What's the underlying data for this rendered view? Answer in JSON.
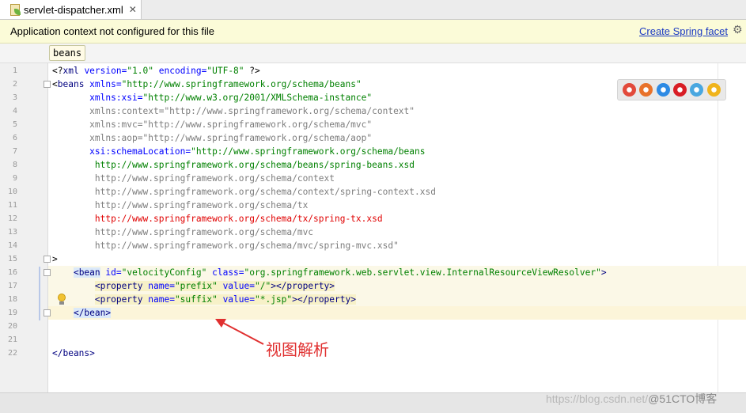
{
  "tab": {
    "label": "servlet-dispatcher.xml",
    "close": "✕",
    "icon": "spring-xml-file-icon"
  },
  "banner": {
    "message": "Application context not configured for this file",
    "link": "Create Spring facet",
    "gear_icon": "gear-icon"
  },
  "breadcrumb": {
    "item": "beans"
  },
  "editor": {
    "line_numbers": [
      "1",
      "2",
      "3",
      "4",
      "5",
      "6",
      "7",
      "8",
      "9",
      "10",
      "11",
      "12",
      "13",
      "14",
      "15",
      "16",
      "17",
      "18",
      "19",
      "20",
      "21",
      "22"
    ],
    "lines": [
      {
        "segments": [
          {
            "t": "<?",
            "c": "bk"
          },
          {
            "t": "xml",
            "c": "tag"
          },
          {
            "t": " version=",
            "c": "attr"
          },
          {
            "t": "\"1.0\"",
            "c": "str"
          },
          {
            "t": " encoding=",
            "c": "attr"
          },
          {
            "t": "\"UTF-8\"",
            "c": "str"
          },
          {
            "t": " ?>",
            "c": "bk"
          }
        ]
      },
      {
        "segments": [
          {
            "t": "<",
            "c": "bk"
          },
          {
            "t": "beans",
            "c": "tag"
          },
          {
            "t": " xmlns=",
            "c": "attr"
          },
          {
            "t": "\"http://www.springframework.org/schema/beans\"",
            "c": "str"
          }
        ]
      },
      {
        "segments": [
          {
            "t": "       xmlns:xsi=",
            "c": "attr"
          },
          {
            "t": "\"http://www.w3.org/2001/XMLSchema-instance\"",
            "c": "str"
          }
        ]
      },
      {
        "segments": [
          {
            "t": "       xmlns:context=\"http://www.springframework.org/schema/context\"",
            "c": "gray"
          }
        ]
      },
      {
        "segments": [
          {
            "t": "       xmlns:mvc=\"http://www.springframework.org/schema/mvc\"",
            "c": "gray"
          }
        ]
      },
      {
        "segments": [
          {
            "t": "       xmlns:aop=\"http://www.springframework.org/schema/aop\"",
            "c": "gray"
          }
        ]
      },
      {
        "segments": [
          {
            "t": "       xsi:schemaLocation=",
            "c": "attr"
          },
          {
            "t": "\"http://www.springframework.org/schema/beans",
            "c": "str"
          }
        ]
      },
      {
        "segments": [
          {
            "t": "        http://www.springframework.org/schema/beans/spring-beans.xsd",
            "c": "str"
          }
        ]
      },
      {
        "segments": [
          {
            "t": "        http://www.springframework.org/schema/context",
            "c": "gray"
          }
        ]
      },
      {
        "segments": [
          {
            "t": "        http://www.springframework.org/schema/context/spring-context.xsd",
            "c": "gray"
          }
        ]
      },
      {
        "segments": [
          {
            "t": "        http://www.springframework.org/schema/tx",
            "c": "gray"
          }
        ]
      },
      {
        "segments": [
          {
            "t": "        http://www.springframework.org/schema/tx/spring-tx.xsd",
            "c": "red"
          }
        ]
      },
      {
        "segments": [
          {
            "t": "        http://www.springframework.org/schema/mvc",
            "c": "gray"
          }
        ]
      },
      {
        "segments": [
          {
            "t": "        http://www.springframework.org/schema/mvc/spring-mvc.xsd\"",
            "c": "gray"
          }
        ]
      },
      {
        "segments": [
          {
            "t": ">",
            "c": "bk"
          }
        ]
      },
      {
        "segments": [
          {
            "t": "    ",
            "c": "bk"
          },
          {
            "t": "<bean",
            "c": "tag",
            "bg": "blue"
          },
          {
            "t": " id=",
            "c": "attr"
          },
          {
            "t": "\"velocityConfig\"",
            "c": "str"
          },
          {
            "t": " class=",
            "c": "attr"
          },
          {
            "t": "\"org.springframework.web.servlet.view.InternalResourceViewResolver\"",
            "c": "str"
          },
          {
            "t": ">",
            "c": "tag"
          }
        ]
      },
      {
        "segments": [
          {
            "t": "        ",
            "c": "bk"
          },
          {
            "t": "<property",
            "c": "tag",
            "bg": "yellow"
          },
          {
            "t": " name=",
            "c": "attr",
            "bg": "yellow"
          },
          {
            "t": "\"prefix\"",
            "c": "str",
            "bg": "yellow"
          },
          {
            "t": " value=",
            "c": "attr",
            "bg": "yellow"
          },
          {
            "t": "\"/\"",
            "c": "str",
            "bg": "yellow"
          },
          {
            "t": "></property>",
            "c": "tag",
            "bg": "yellow"
          }
        ]
      },
      {
        "segments": [
          {
            "t": "        ",
            "c": "bk"
          },
          {
            "t": "<property",
            "c": "tag",
            "bg": "yellow"
          },
          {
            "t": " name=",
            "c": "attr",
            "bg": "yellow"
          },
          {
            "t": "\"suffix\"",
            "c": "str",
            "bg": "yellow"
          },
          {
            "t": " value=",
            "c": "attr",
            "bg": "yellow"
          },
          {
            "t": "\"*.jsp\"",
            "c": "str",
            "bg": "yellow"
          },
          {
            "t": "></property>",
            "c": "tag",
            "bg": "yellow"
          }
        ]
      },
      {
        "segments": [
          {
            "t": "    ",
            "c": "bk"
          },
          {
            "t": "</bean>",
            "c": "tag",
            "bg": "blue"
          }
        ]
      },
      {
        "segments": []
      },
      {
        "segments": []
      },
      {
        "segments": [
          {
            "t": "</beans>",
            "c": "tag"
          }
        ]
      }
    ],
    "fold_markers_on_lines": [
      2,
      15,
      16,
      19
    ],
    "highlighted_block_lines": [
      16,
      17,
      18,
      19
    ],
    "caret_line": 19
  },
  "browser_preview_icons": [
    "chrome-icon",
    "firefox-icon",
    "safari-icon",
    "opera-icon",
    "ie-icon",
    "chrome-canary-icon"
  ],
  "browser_colors": [
    "#e24a3b",
    "#e8722a",
    "#2d8ae4",
    "#d81d25",
    "#49a7e0",
    "#f0b41c"
  ],
  "annotation": {
    "text": "视图解析",
    "color": "#e03030"
  },
  "watermark": {
    "url": "https://blog.csdn.net/",
    "brand": "@51CTO博客"
  },
  "colors": {
    "tag": "#000080",
    "attr": "#0000ff",
    "str": "#008000",
    "gray": "#7d7d7d",
    "red": "#e00000",
    "link": "#1a39c2"
  }
}
